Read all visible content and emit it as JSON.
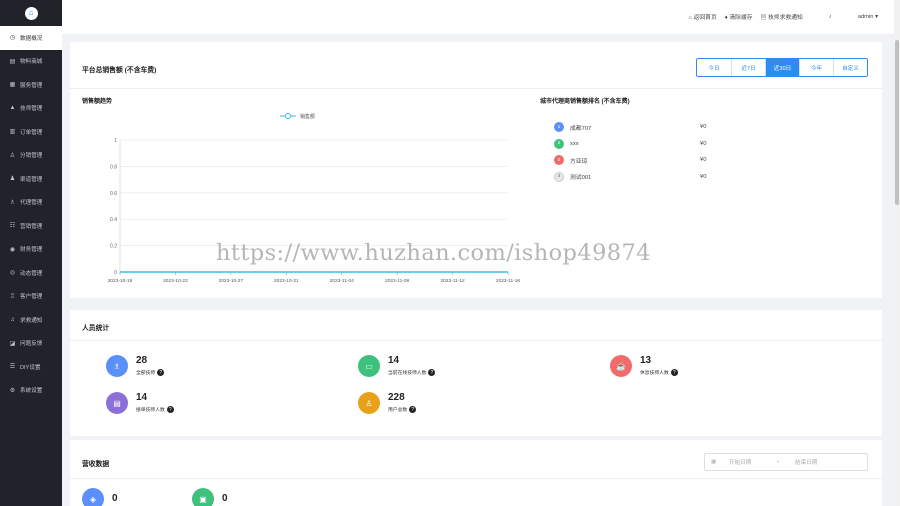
{
  "sidebar": {
    "logo_icon": "home-icon",
    "items": [
      {
        "icon": "◷",
        "label": "数据概况",
        "active": true
      },
      {
        "icon": "▤",
        "label": "物料商城"
      },
      {
        "icon": "▦",
        "label": "服务管理"
      },
      {
        "icon": "▲",
        "label": "技师管理"
      },
      {
        "icon": "▥",
        "label": "订单管理"
      },
      {
        "icon": "♙",
        "label": "分销管理"
      },
      {
        "icon": "♟",
        "label": "渠道管理"
      },
      {
        "icon": "♗",
        "label": "代理管理"
      },
      {
        "icon": "☷",
        "label": "营销管理"
      },
      {
        "icon": "◉",
        "label": "财务管理"
      },
      {
        "icon": "◎",
        "label": "动态管理"
      },
      {
        "icon": "♖",
        "label": "客户管理"
      },
      {
        "icon": "♫",
        "label": "求救通知"
      },
      {
        "icon": "◪",
        "label": "问题反馈"
      },
      {
        "icon": "☰",
        "label": "DIY设置"
      },
      {
        "icon": "⚙",
        "label": "系统设置"
      }
    ]
  },
  "topbar": {
    "home_label": "返回首页",
    "clear_cache_label": "清除缓存",
    "notify_label": "技师求救通知",
    "user_label": "admin ▾",
    "home_icon": "home-icon",
    "cache_icon": "broom-icon",
    "notify_icon": "trash-icon",
    "bell_icon": "bell-icon"
  },
  "sales_card": {
    "title": "平台总销售额 (不含车费)",
    "ranges": [
      "今日",
      "近7日",
      "近30日",
      "今年",
      "自定义"
    ],
    "active_range": 2,
    "trend_title": "销售额趋势",
    "rank_title": "城市代理商销售额排名 (不含车费)",
    "rank": [
      {
        "no": "1",
        "name": "成都707",
        "value": "¥0",
        "color": "#5b8ff9"
      },
      {
        "no": "2",
        "name": "xxx",
        "value": "¥0",
        "color": "#3ec17c"
      },
      {
        "no": "3",
        "name": "方亚琼",
        "value": "¥0",
        "color": "#f26b6b"
      },
      {
        "no": "4",
        "name": "测试001",
        "value": "¥0",
        "color": "#e8e8e8"
      }
    ]
  },
  "chart_data": {
    "type": "line",
    "x": [
      "2023-10-19",
      "2023-10-23",
      "2023-10-27",
      "2023-10-31",
      "2023-11-04",
      "2023-11-08",
      "2023-11-12",
      "2023-11-16"
    ],
    "series": [
      {
        "name": "销售额",
        "values": [
          0,
          0,
          0,
          0,
          0,
          0,
          0,
          0
        ],
        "color": "#41b8e8"
      }
    ],
    "y_ticks": [
      "0",
      "0.2",
      "0.4",
      "0.6",
      "0.8",
      "1"
    ],
    "ylim": [
      0,
      1
    ],
    "grid": true,
    "legend": "top-center"
  },
  "staff_card": {
    "title": "人员统计",
    "stats": [
      {
        "value": "28",
        "label": "全部技师",
        "color": "#5b8ff9",
        "icon": "people-icon"
      },
      {
        "value": "14",
        "label": "当前在线技师人数",
        "color": "#3ec17c",
        "icon": "monitor-icon"
      },
      {
        "value": "13",
        "label": "休息技师人数",
        "color": "#f26b6b",
        "icon": "coffee-icon"
      },
      {
        "value": "14",
        "label": "接单技师人数",
        "color": "#8c6fd8",
        "icon": "clipboard-icon"
      },
      {
        "value": "228",
        "label": "用户总数",
        "color": "#e8a21a",
        "icon": "user-icon"
      }
    ]
  },
  "revenue_card": {
    "title": "营收数据",
    "start_placeholder": "开始日期",
    "separator": "-",
    "end_placeholder": "结束日期",
    "stats": [
      {
        "value": "0",
        "color": "#5b8ff9",
        "icon": "wallet-icon"
      },
      {
        "value": "0",
        "color": "#3ec17c",
        "icon": "bag-icon"
      }
    ]
  },
  "watermark": "https://www.huzhan.com/ishop49874"
}
